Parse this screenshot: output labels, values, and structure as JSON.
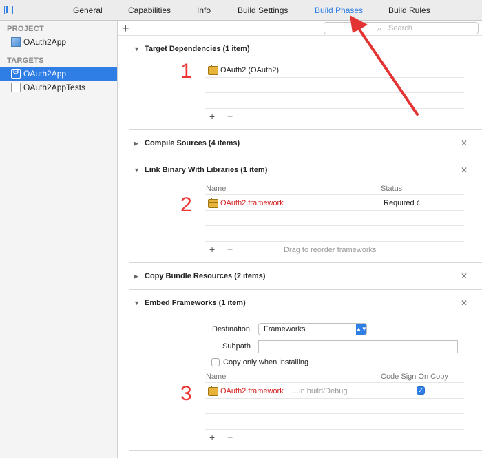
{
  "tabs": [
    "General",
    "Capabilities",
    "Info",
    "Build Settings",
    "Build Phases",
    "Build Rules"
  ],
  "active_tab": "Build Phases",
  "sidebar": {
    "project_header": "PROJECT",
    "project_item": "OAuth2App",
    "targets_header": "TARGETS",
    "targets": [
      "OAuth2App",
      "OAuth2AppTests"
    ]
  },
  "toolbar": {
    "add_label": "+",
    "search_placeholder": "Search"
  },
  "phases": {
    "target_dependencies": {
      "title": "Target Dependencies (1 item)",
      "items": [
        "OAuth2 (OAuth2)"
      ]
    },
    "compile_sources": {
      "title": "Compile Sources (4 items)"
    },
    "link_binary": {
      "title": "Link Binary With Libraries (1 item)",
      "col_name": "Name",
      "col_status": "Status",
      "items": [
        {
          "name": "OAuth2.framework",
          "status": "Required"
        }
      ],
      "hint": "Drag to reorder frameworks"
    },
    "copy_bundle": {
      "title": "Copy Bundle Resources (2 items)"
    },
    "embed_frameworks": {
      "title": "Embed Frameworks (1 item)",
      "destination_label": "Destination",
      "destination_value": "Frameworks",
      "subpath_label": "Subpath",
      "subpath_value": "",
      "copy_only_label": "Copy only when installing",
      "col_name": "Name",
      "col_codesign": "Code Sign On Copy",
      "items": [
        {
          "name": "OAuth2.framework",
          "path": "...in build/Debug"
        }
      ]
    }
  },
  "annotations": [
    "1",
    "2",
    "3"
  ],
  "colors": {
    "accent": "#2f7ee6",
    "annotation_red": "#e33333",
    "framework_red": "#d42222"
  }
}
